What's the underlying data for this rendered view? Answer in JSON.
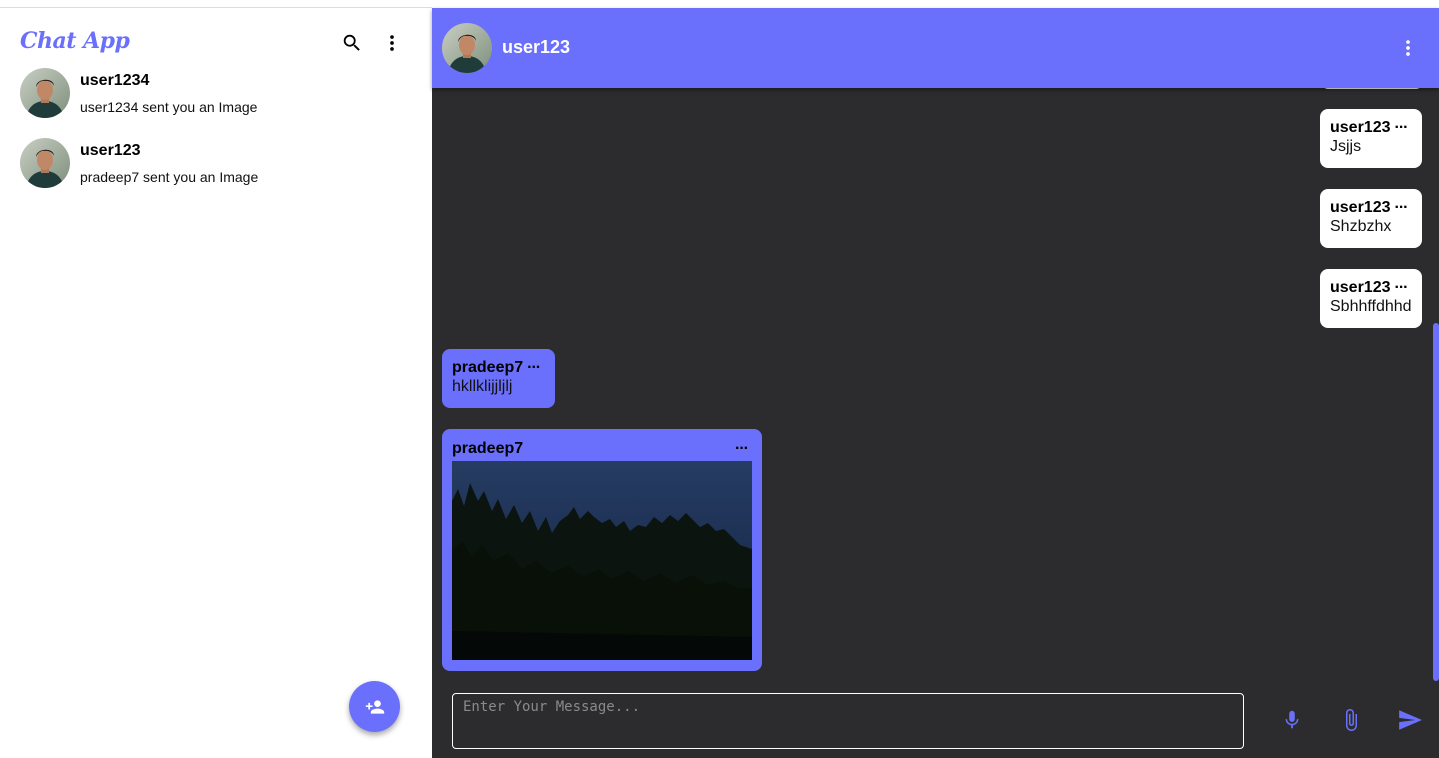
{
  "sidebar": {
    "app_title": "Chat App",
    "contacts": [
      {
        "name": "user1234",
        "last_message": "user1234 sent you an Image"
      },
      {
        "name": "user123",
        "last_message": "pradeep7 sent you an Image"
      }
    ],
    "add_contact_icon": "person-add-icon",
    "search_icon": "search-icon",
    "menu_icon": "more-vertical-icon"
  },
  "chat": {
    "header": {
      "name": "user123",
      "menu_icon": "more-vertical-icon"
    },
    "messages": [
      {
        "sender": "user123",
        "text": "Jsjjs",
        "direction": "outgoing"
      },
      {
        "sender": "user123",
        "text": "Shzbzhx",
        "direction": "outgoing"
      },
      {
        "sender": "user123",
        "text": "Sbhhffdhhd",
        "direction": "outgoing"
      },
      {
        "sender": "pradeep7",
        "text": "hkllklijjljlj",
        "direction": "incoming"
      },
      {
        "sender": "pradeep7",
        "type": "image",
        "direction": "incoming"
      }
    ],
    "options_glyph": "···",
    "input": {
      "placeholder": "Enter Your Message...",
      "value": ""
    },
    "actions": {
      "mic_icon": "mic-icon",
      "attach_icon": "attach-icon",
      "send_icon": "send-icon"
    }
  },
  "colors": {
    "accent": "#6b70fc",
    "chat_bg": "#2c2c2e",
    "bubble_out": "#ffffff"
  }
}
